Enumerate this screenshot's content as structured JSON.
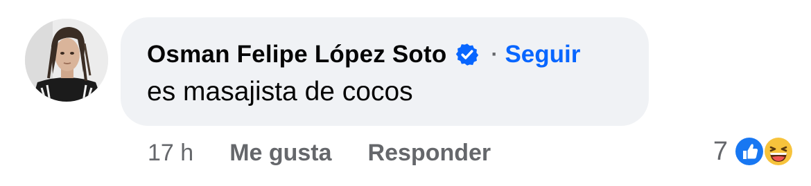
{
  "comment": {
    "author": "Osman Felipe López Soto",
    "verified_icon": "verified-badge-icon",
    "separator": "·",
    "follow_label": "Seguir",
    "text": "es masajista de cocos",
    "time": "17 h",
    "like_label": "Me gusta",
    "reply_label": "Responder",
    "reaction_count": "7",
    "reactions": [
      "like-reaction-icon",
      "haha-reaction-icon"
    ]
  },
  "colors": {
    "bubble_bg": "#f0f2f5",
    "link_blue": "#0866ff",
    "secondary_text": "#65676b",
    "primary_text": "#050505"
  }
}
